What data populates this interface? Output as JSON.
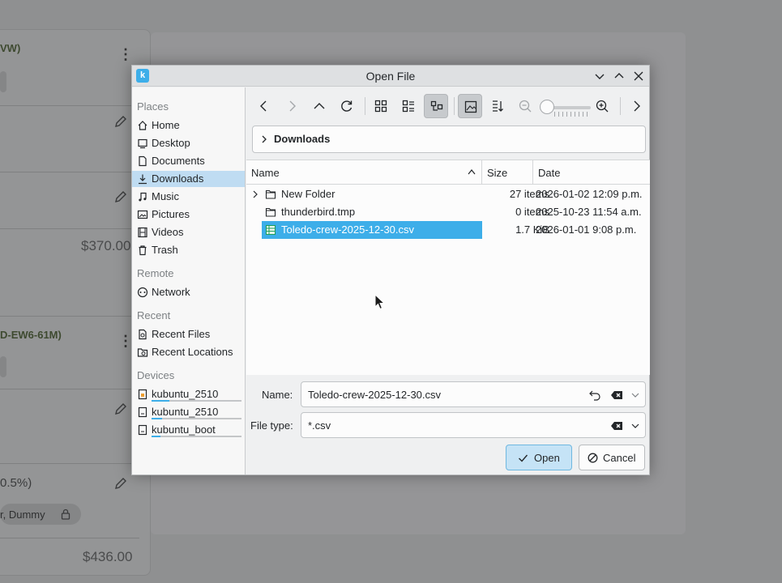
{
  "background": {
    "card_title_1": "VW)",
    "card_title_2": "D-EW6-61M)",
    "price_1": "$370.00",
    "percent": "0.5%)",
    "assignees": "r, Dummy",
    "price_2": "$436.00"
  },
  "dialog": {
    "title": "Open File",
    "places": {
      "sections": {
        "places": "Places",
        "remote": "Remote",
        "recent": "Recent",
        "devices": "Devices"
      },
      "items": [
        {
          "label": "Home",
          "icon": "home-icon"
        },
        {
          "label": "Desktop",
          "icon": "desktop-icon"
        },
        {
          "label": "Documents",
          "icon": "documents-icon"
        },
        {
          "label": "Downloads",
          "icon": "downloads-icon",
          "selected": true
        },
        {
          "label": "Music",
          "icon": "music-icon"
        },
        {
          "label": "Pictures",
          "icon": "pictures-icon"
        },
        {
          "label": "Videos",
          "icon": "videos-icon"
        },
        {
          "label": "Trash",
          "icon": "trash-icon"
        }
      ],
      "remote": [
        {
          "label": "Network",
          "icon": "network-icon"
        }
      ],
      "recent": [
        {
          "label": "Recent Files",
          "icon": "recent-files-icon"
        },
        {
          "label": "Recent Locations",
          "icon": "recent-locations-icon"
        }
      ],
      "devices": [
        {
          "label": "kubuntu_2510",
          "icon": "drive-locked-icon",
          "usage": 0.2
        },
        {
          "label": "kubuntu_2510",
          "icon": "drive-icon",
          "usage": 0.12
        },
        {
          "label": "kubuntu_boot",
          "icon": "drive-icon",
          "usage": 0.1
        }
      ]
    },
    "breadcrumb": "Downloads",
    "columns": {
      "name": "Name",
      "size": "Size",
      "date": "Date"
    },
    "files": [
      {
        "name": "New Folder",
        "size": "27 items",
        "date": "2026-01-02 12:09 p.m.",
        "type": "folder",
        "expandable": true
      },
      {
        "name": "thunderbird.tmp",
        "size": "0 items",
        "date": "2025-10-23 11:54 a.m.",
        "type": "folder"
      },
      {
        "name": "Toledo-crew-2025-12-30.csv",
        "size": "1.7 KiB",
        "date": "2026-01-01 9:08 p.m.",
        "type": "csv",
        "selected": true
      }
    ],
    "form": {
      "name_label": "Name:",
      "name_value": "Toledo-crew-2025-12-30.csv",
      "type_label": "File type:",
      "type_value": "*.csv",
      "open_label": "Open",
      "cancel_label": "Cancel"
    },
    "colors": {
      "accent": "#3daee9",
      "selection": "#bfdcf2"
    }
  }
}
